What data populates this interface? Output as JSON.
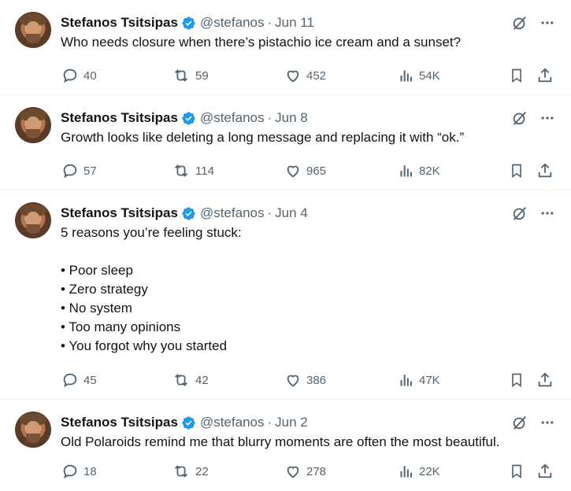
{
  "tweets": [
    {
      "name": "Stefanos Tsitsipas",
      "handle": "@stefanos",
      "separator": "·",
      "date": "Jun 11",
      "text": "Who needs closure when there’s pistachio ice cream and a sunset?",
      "replies": "40",
      "retweets": "59",
      "likes": "452",
      "views": "54K"
    },
    {
      "name": "Stefanos Tsitsipas",
      "handle": "@stefanos",
      "separator": "·",
      "date": "Jun 8",
      "text": "Growth looks like deleting a long message and replacing it with “ok.”",
      "replies": "57",
      "retweets": "114",
      "likes": "965",
      "views": "82K"
    },
    {
      "name": "Stefanos Tsitsipas",
      "handle": "@stefanos",
      "separator": "·",
      "date": "Jun 4",
      "text": "5 reasons you’re feeling stuck:\n\n• Poor sleep\n• Zero strategy\n• No system\n• Too many opinions\n• You forgot why you started",
      "replies": "45",
      "retweets": "42",
      "likes": "386",
      "views": "47K"
    },
    {
      "name": "Stefanos Tsitsipas",
      "handle": "@stefanos",
      "separator": "·",
      "date": "Jun 2",
      "text": "Old Polaroids remind me that blurry moments are often the most beautiful.",
      "replies": "18",
      "retweets": "22",
      "likes": "278",
      "views": "22K"
    }
  ],
  "colors": {
    "verified": "#1d9bf0",
    "muted": "#536471",
    "text": "#0f1419"
  },
  "icons": [
    "grok-icon",
    "more-icon",
    "reply-icon",
    "retweet-icon",
    "like-icon",
    "views-icon",
    "bookmark-icon",
    "share-icon",
    "verified-badge-icon"
  ]
}
